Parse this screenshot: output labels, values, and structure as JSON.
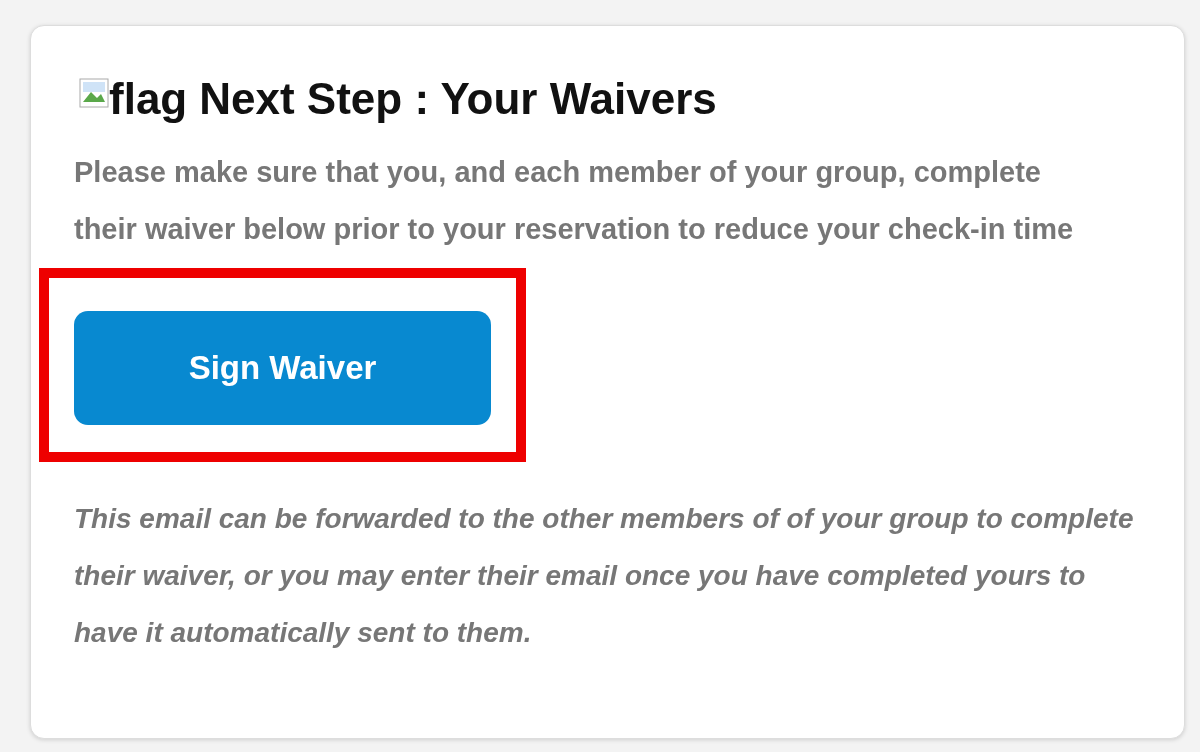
{
  "heading": {
    "image_alt": "flag",
    "text": "Next Step : Your Waivers"
  },
  "intro": "Please make sure that you, and each member of your group, complete their waiver below prior to your reservation to reduce your check-in time",
  "button": {
    "label": "Sign Waiver",
    "highlighted": true
  },
  "note": "This email can be forwarded to the other members of of your group to complete their waiver, or you may enter their email once you have completed yours to have it automatically sent to them."
}
